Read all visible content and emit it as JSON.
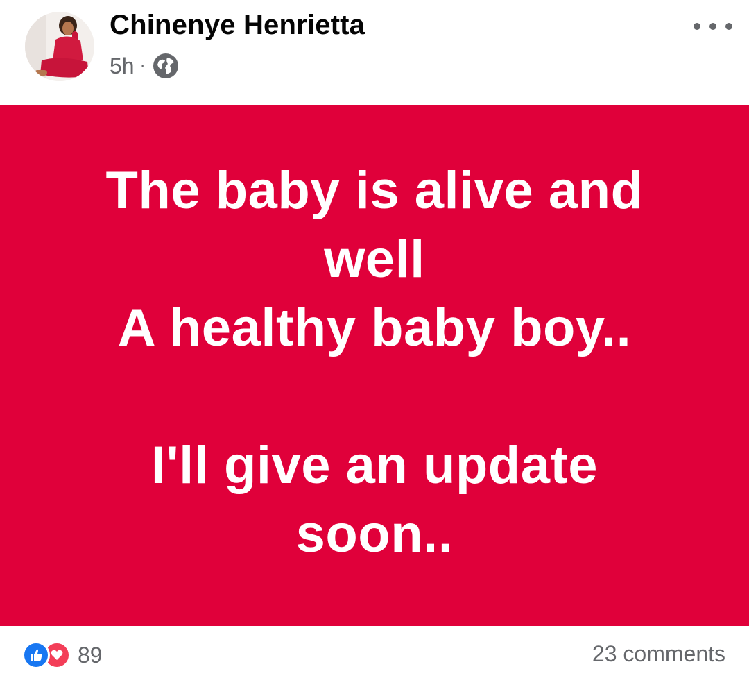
{
  "post": {
    "author": "Chinenye Henrietta",
    "time": "5h",
    "separator": "·",
    "privacy_icon": "globe-icon",
    "more_icon": "more-options-icon",
    "status_text": "The baby is alive and\nwell\nA healthy baby boy..\n\nI'll give an update\nsoon..",
    "background_color": "#e0003a",
    "reactions": {
      "icons": [
        "like-icon",
        "love-icon"
      ],
      "count": "89"
    },
    "comments": "23 comments"
  }
}
